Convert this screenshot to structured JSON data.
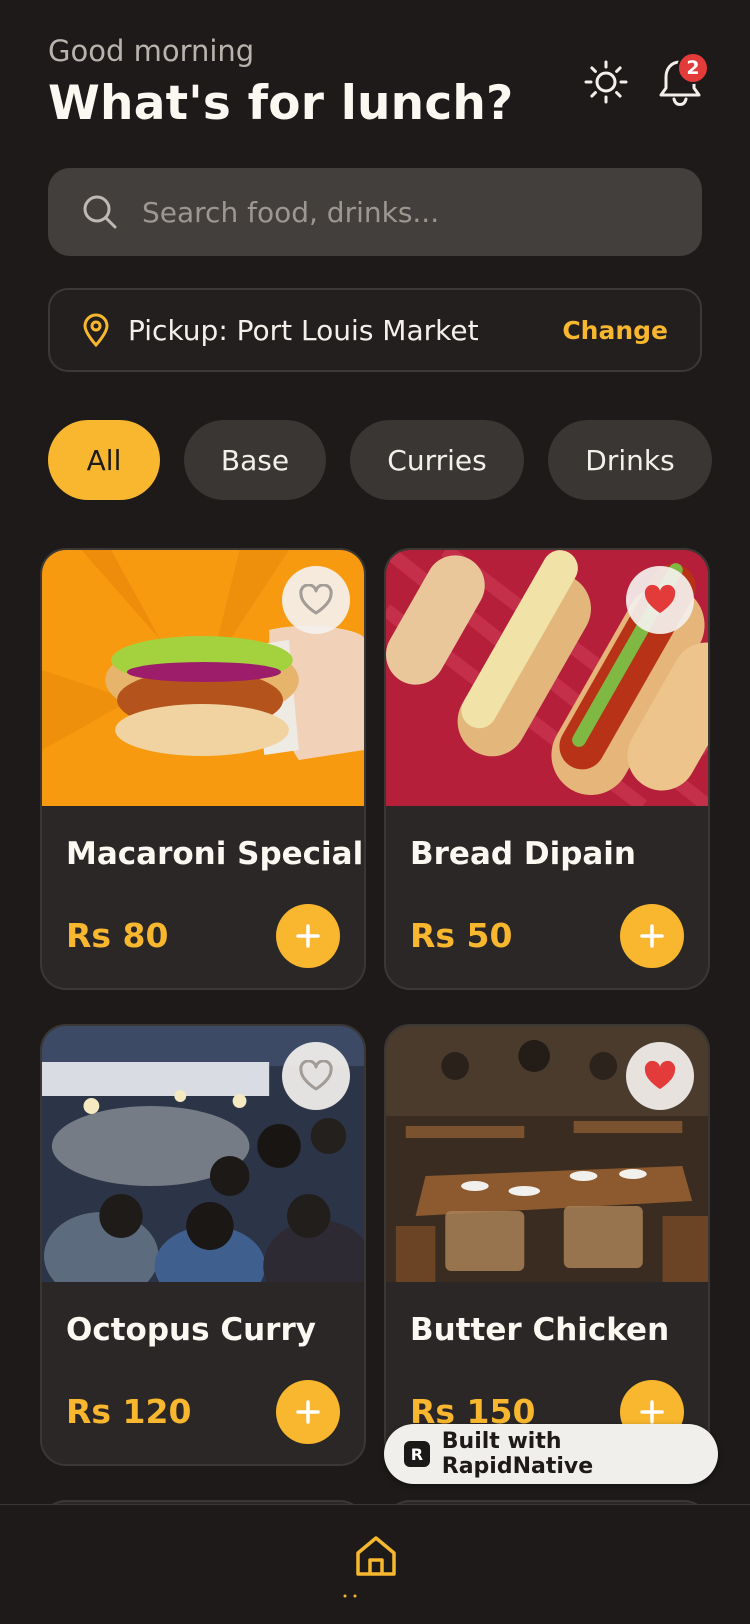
{
  "header": {
    "greeting": "Good morning",
    "title": "What's for lunch?",
    "notification_count": "2"
  },
  "search": {
    "placeholder": "Search food, drinks..."
  },
  "pickup": {
    "label": "Pickup: Port Louis Market",
    "change": "Change"
  },
  "categories": [
    {
      "label": "All",
      "active": true
    },
    {
      "label": "Base"
    },
    {
      "label": "Curries"
    },
    {
      "label": "Drinks"
    }
  ],
  "items": [
    {
      "name": "Macaroni Special",
      "price": "Rs 80",
      "favorite": false
    },
    {
      "name": "Bread Dipain",
      "price": "Rs 50",
      "favorite": true
    },
    {
      "name": "Octopus Curry",
      "price": "Rs 120",
      "favorite": false
    },
    {
      "name": "Butter Chicken",
      "price": "Rs 150",
      "favorite": true
    }
  ],
  "built_with": "Built with RapidNative",
  "colors": {
    "accent": "#f8b72e",
    "background": "#1d1a19",
    "card": "#2a2726",
    "favorite": "#e33a3a"
  }
}
